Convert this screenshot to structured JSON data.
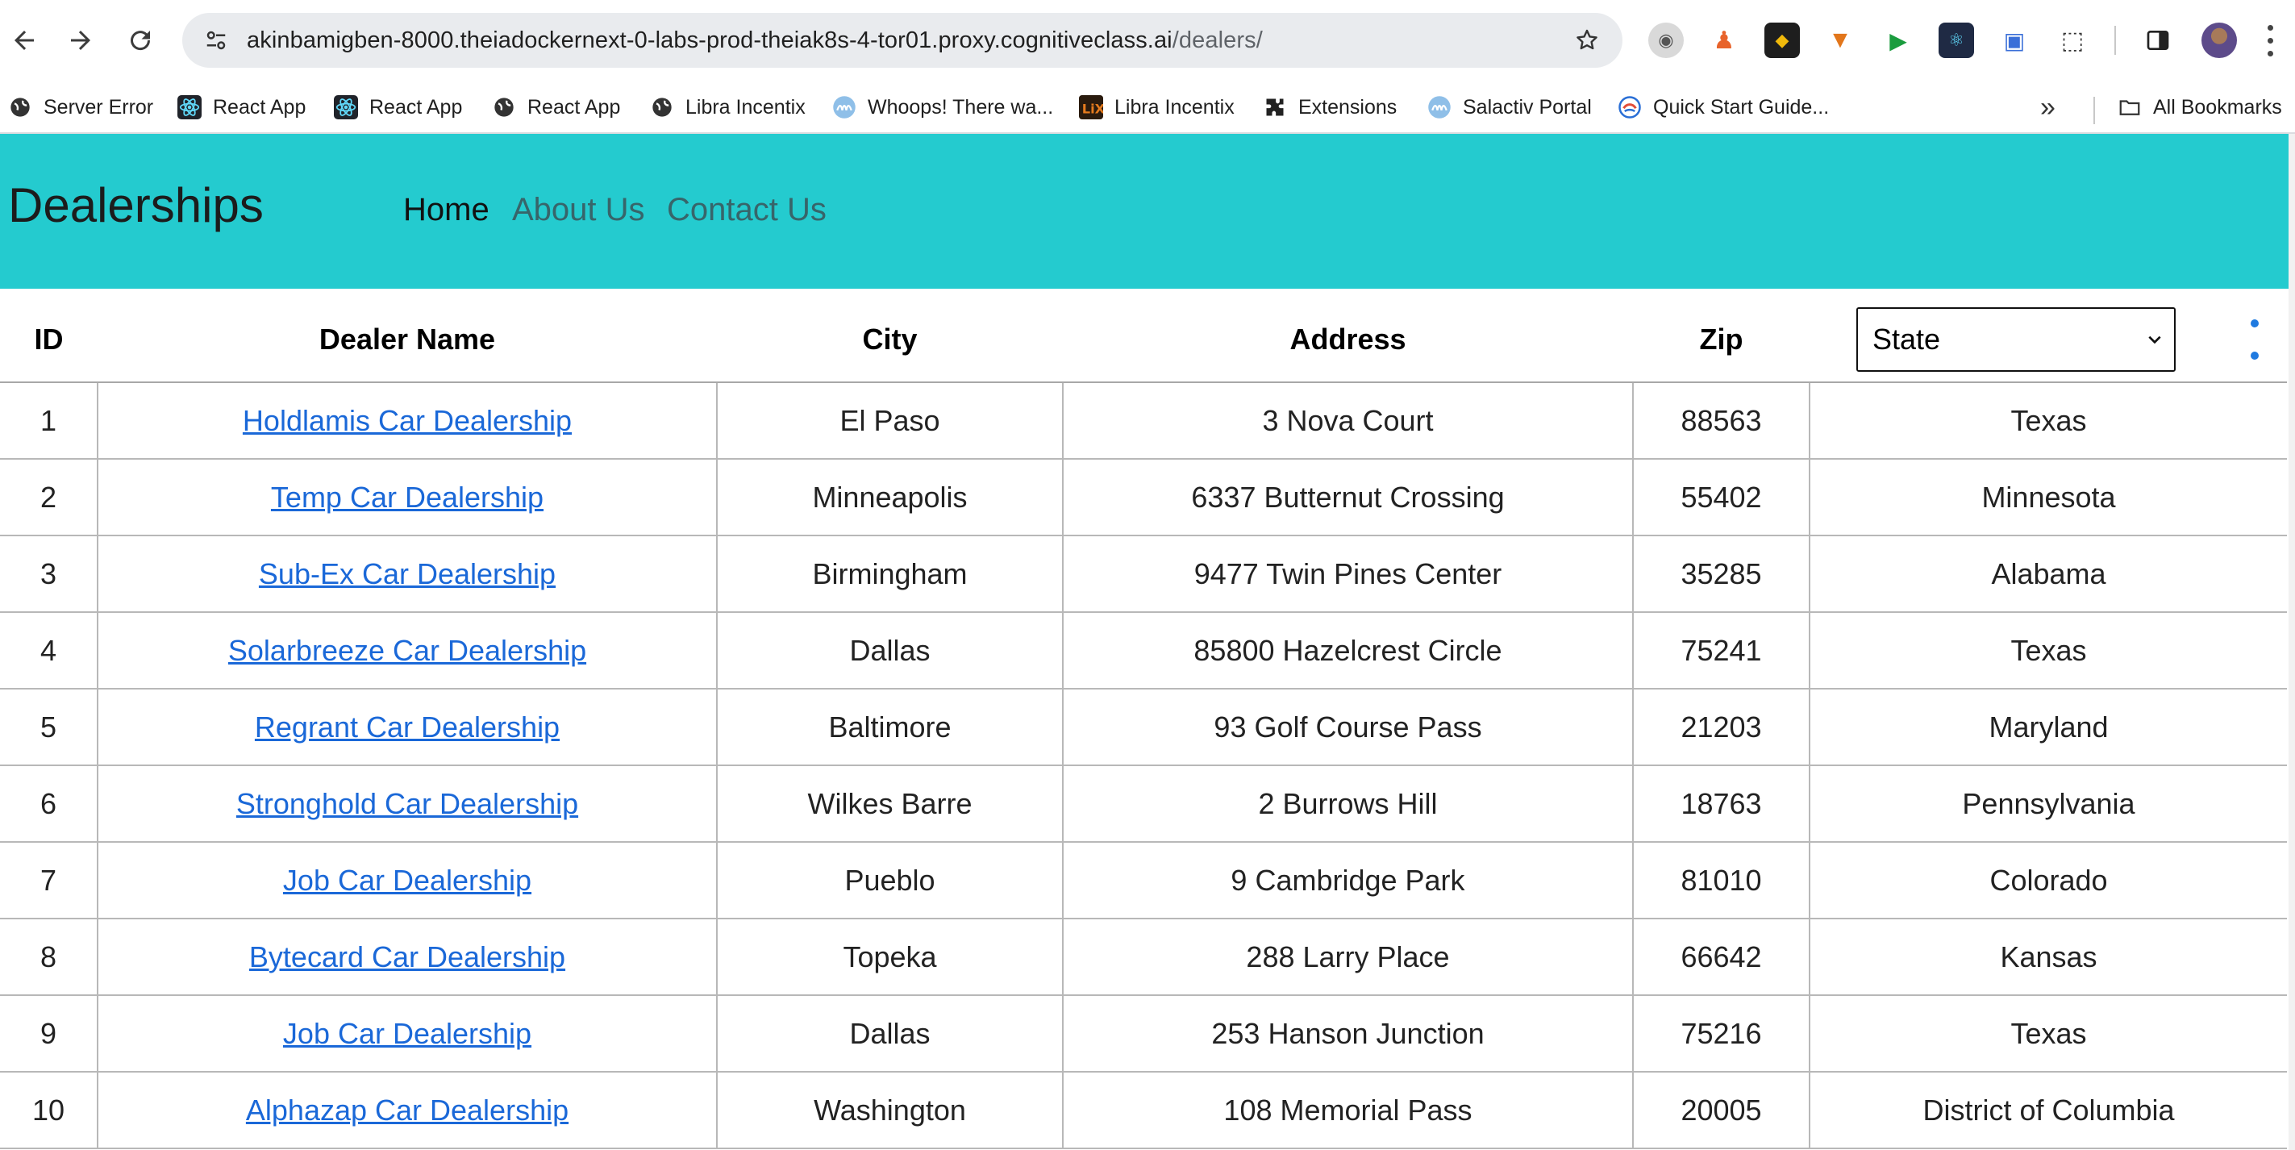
{
  "browser": {
    "url_host": "akinbamigben-8000.theiadockernext-0-labs-prod-theiak8s-4-tor01.proxy.cognitiveclass.ai",
    "url_path": "/dealers/",
    "bookmarks": [
      {
        "label": "Server Error",
        "icon": "globe-icon"
      },
      {
        "label": "React App",
        "icon": "react-icon"
      },
      {
        "label": "React App",
        "icon": "react-icon"
      },
      {
        "label": "React App",
        "icon": "globe-icon"
      },
      {
        "label": "Libra Incentix",
        "icon": "globe-icon"
      },
      {
        "label": "Whoops! There wa...",
        "icon": "wave-icon"
      },
      {
        "label": "Libra Incentix",
        "icon": "lix-icon"
      },
      {
        "label": "Extensions",
        "icon": "puzzle-icon"
      },
      {
        "label": "Salactiv Portal",
        "icon": "wave-icon"
      },
      {
        "label": "Quick Start Guide...",
        "icon": "swirl-icon"
      }
    ],
    "all_bookmarks_label": "All Bookmarks"
  },
  "site": {
    "brand": "Dealerships",
    "nav": {
      "home": "Home",
      "about": "About Us",
      "contact": "Contact Us"
    }
  },
  "table": {
    "headers": {
      "id": "ID",
      "name": "Dealer Name",
      "city": "City",
      "address": "Address",
      "zip": "Zip",
      "state_select": "State"
    },
    "rows": [
      {
        "id": "1",
        "name": "Holdlamis Car Dealership",
        "city": "El Paso",
        "address": "3 Nova Court",
        "zip": "88563",
        "state": "Texas"
      },
      {
        "id": "2",
        "name": "Temp Car Dealership",
        "city": "Minneapolis",
        "address": "6337 Butternut Crossing",
        "zip": "55402",
        "state": "Minnesota"
      },
      {
        "id": "3",
        "name": "Sub-Ex Car Dealership",
        "city": "Birmingham",
        "address": "9477 Twin Pines Center",
        "zip": "35285",
        "state": "Alabama"
      },
      {
        "id": "4",
        "name": "Solarbreeze Car Dealership",
        "city": "Dallas",
        "address": "85800 Hazelcrest Circle",
        "zip": "75241",
        "state": "Texas"
      },
      {
        "id": "5",
        "name": "Regrant Car Dealership",
        "city": "Baltimore",
        "address": "93 Golf Course Pass",
        "zip": "21203",
        "state": "Maryland"
      },
      {
        "id": "6",
        "name": "Stronghold Car Dealership",
        "city": "Wilkes Barre",
        "address": "2 Burrows Hill",
        "zip": "18763",
        "state": "Pennsylvania"
      },
      {
        "id": "7",
        "name": "Job Car Dealership",
        "city": "Pueblo",
        "address": "9 Cambridge Park",
        "zip": "81010",
        "state": "Colorado"
      },
      {
        "id": "8",
        "name": "Bytecard Car Dealership",
        "city": "Topeka",
        "address": "288 Larry Place",
        "zip": "66642",
        "state": "Kansas"
      },
      {
        "id": "9",
        "name": "Job Car Dealership",
        "city": "Dallas",
        "address": "253 Hanson Junction",
        "zip": "75216",
        "state": "Texas"
      },
      {
        "id": "10",
        "name": "Alphazap Car Dealership",
        "city": "Washington",
        "address": "108 Memorial Pass",
        "zip": "20005",
        "state": "District of Columbia"
      }
    ]
  },
  "colors": {
    "header_bg": "#24cbcf",
    "link": "#1a68d8",
    "nav_inactive": "#37656a"
  }
}
